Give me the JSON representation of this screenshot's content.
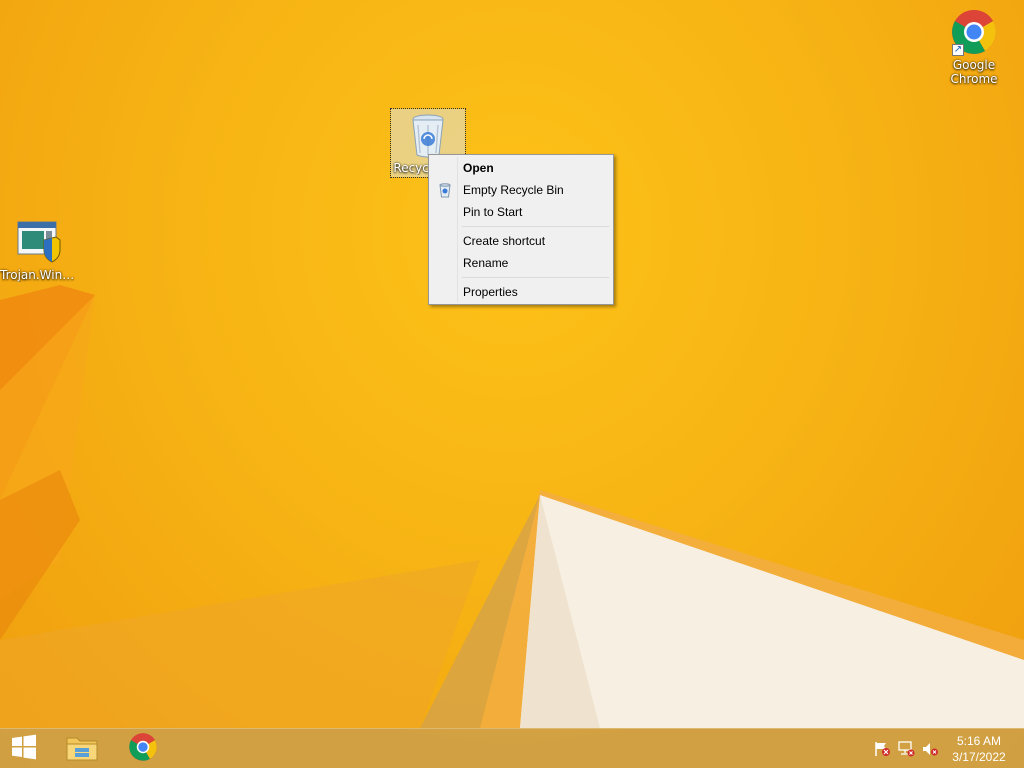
{
  "desktop": {
    "icons": [
      {
        "label": "Recycle Bin",
        "icon": "recycle-bin-icon"
      },
      {
        "label": "Trojan.Win3...",
        "icon": "program-shield-icon"
      },
      {
        "label": "Google Chrome",
        "icon": "chrome-icon"
      }
    ]
  },
  "context_menu": {
    "items": [
      {
        "label": "Open",
        "bold": true
      },
      {
        "label": "Empty Recycle Bin",
        "icon": "recycle-bin-small-icon"
      },
      {
        "label": "Pin to Start"
      },
      {
        "label": "Create shortcut"
      },
      {
        "label": "Rename"
      },
      {
        "label": "Properties"
      }
    ]
  },
  "taskbar": {
    "buttons": [
      {
        "name": "Start",
        "icon": "windows-logo-icon"
      },
      {
        "name": "File Explorer",
        "icon": "folder-icon"
      },
      {
        "name": "Google Chrome",
        "icon": "chrome-icon"
      }
    ],
    "tray": {
      "icons": [
        "action-center-flag-icon",
        "network-icon",
        "volume-muted-icon"
      ],
      "time": "5:16 AM",
      "date": "3/17/2022"
    }
  },
  "colors": {
    "wallpaper": "#f5b212",
    "menu_background": "#f0f0f0",
    "taskbar": "#cda046"
  }
}
